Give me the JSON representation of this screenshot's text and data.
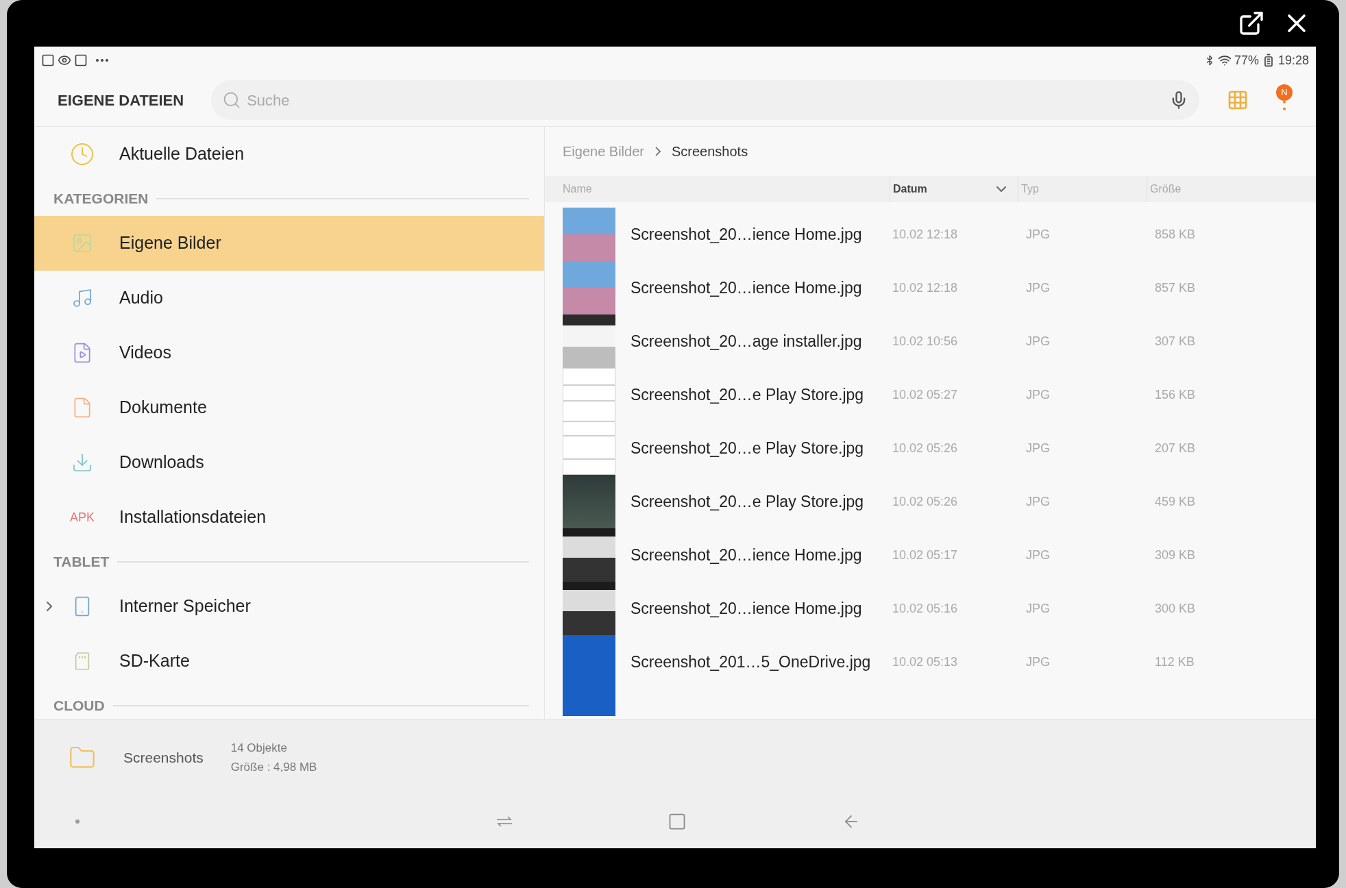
{
  "status_bar": {
    "battery": "77%",
    "time": "19:28"
  },
  "header": {
    "title": "EIGENE DATEIEN",
    "search": {
      "placeholder": "Suche"
    },
    "badge": "N"
  },
  "sidebar": {
    "top": [
      {
        "label": "Aktuelle Dateien",
        "selected": false
      }
    ],
    "sections": [
      {
        "title": "KATEGORIEN",
        "items": [
          {
            "label": "Eigene Bilder",
            "selected": true
          },
          {
            "label": "Audio",
            "selected": false
          },
          {
            "label": "Videos",
            "selected": false
          },
          {
            "label": "Dokumente",
            "selected": false
          },
          {
            "label": "Downloads",
            "selected": false
          },
          {
            "label": "Installationsdateien",
            "selected": false,
            "icon_text": "APK"
          }
        ]
      },
      {
        "title": "TABLET",
        "items": [
          {
            "label": "Interner Speicher",
            "selected": false,
            "expanded": false
          },
          {
            "label": "SD-Karte",
            "selected": false
          }
        ]
      },
      {
        "title": "CLOUD"
      }
    ]
  },
  "breadcrumb": [
    "Eigene Bilder",
    "Screenshots"
  ],
  "table": {
    "columns": [
      {
        "label": "Name",
        "sorted": false
      },
      {
        "label": "Datum",
        "sorted": true
      },
      {
        "label": "Typ",
        "sorted": false
      },
      {
        "label": "Größe",
        "sorted": false
      }
    ],
    "rows": [
      {
        "name": "Screenshot_20…ience Home.jpg",
        "date": "10.02 12:18",
        "type": "JPG",
        "size": "858 KB"
      },
      {
        "name": "Screenshot_20…ience Home.jpg",
        "date": "10.02 12:18",
        "type": "JPG",
        "size": "857 KB"
      },
      {
        "name": "Screenshot_20…age installer.jpg",
        "date": "10.02 10:56",
        "type": "JPG",
        "size": "307 KB"
      },
      {
        "name": "Screenshot_20…e Play Store.jpg",
        "date": "10.02 05:27",
        "type": "JPG",
        "size": "156 KB"
      },
      {
        "name": "Screenshot_20…e Play Store.jpg",
        "date": "10.02 05:26",
        "type": "JPG",
        "size": "207 KB"
      },
      {
        "name": "Screenshot_20…e Play Store.jpg",
        "date": "10.02 05:26",
        "type": "JPG",
        "size": "459 KB"
      },
      {
        "name": "Screenshot_20…ience Home.jpg",
        "date": "10.02 05:17",
        "type": "JPG",
        "size": "309 KB"
      },
      {
        "name": "Screenshot_20…ience Home.jpg",
        "date": "10.02 05:16",
        "type": "JPG",
        "size": "300 KB"
      },
      {
        "name": "Screenshot_201…5_OneDrive.jpg",
        "date": "10.02 05:13",
        "type": "JPG",
        "size": "112 KB"
      }
    ]
  },
  "footer": {
    "folder": "Screenshots",
    "count": "14 Objekte",
    "size": "Größe : 4,98 MB"
  }
}
